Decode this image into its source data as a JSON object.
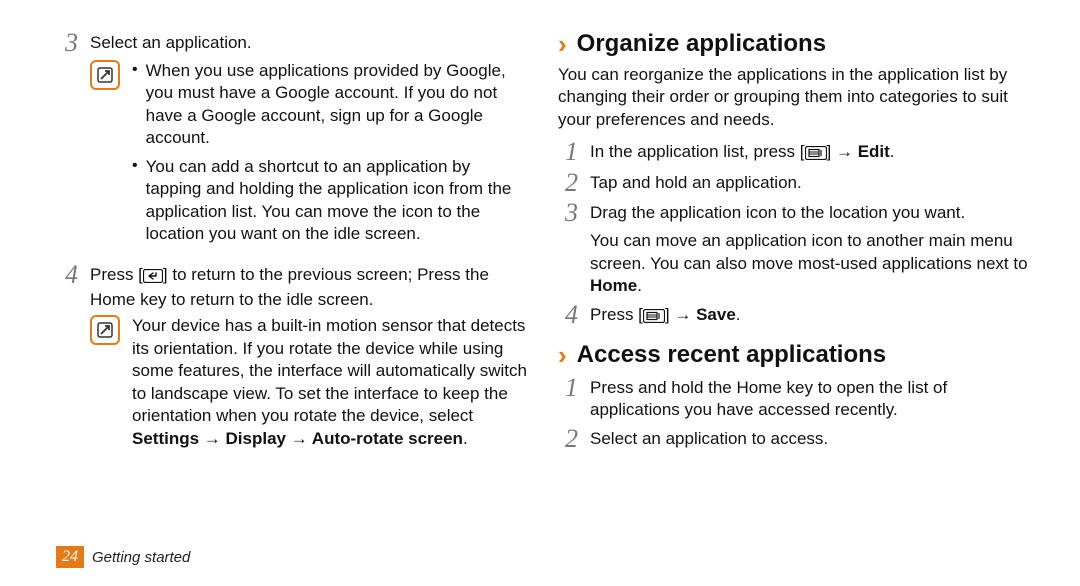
{
  "left": {
    "step3_text": "Select an application.",
    "note1_b1": "When you use applications provided by Google, you must have a Google account. If you do not have a Google account, sign up for a Google account.",
    "note1_b2": "You can add a shortcut to an application by tapping and holding the application icon from the application list. You can move the icon to the location you want on the idle screen.",
    "step4_pre": "Press [",
    "step4_post": "] to return to the previous screen; Press the Home key to return to the idle screen.",
    "note2": "Your device has a built-in motion sensor that detects its orientation. If you rotate the device while using some features, the interface will automatically switch to landscape view. To set the interface to keep the orientation when you rotate the device, select ",
    "note2_bold": "Settings → Display → Auto-rotate screen",
    "note2_tail": "."
  },
  "right": {
    "h_organize": "Organize applications",
    "intro": "You can reorganize the applications in the application list by changing their order or grouping them into categories to suit your preferences and needs.",
    "s1_pre": "In the application list, press [",
    "s1_mid": "] → ",
    "s1_bold": "Edit",
    "s1_tail": ".",
    "s2": "Tap and hold an application.",
    "s3": "Drag the application icon to the location you want.",
    "s3b": "You can move an application icon to another main menu screen. You can also move most-used applications next to ",
    "s3b_bold": "Home",
    "s3b_tail": ".",
    "s4_pre": "Press [",
    "s4_mid": "] → ",
    "s4_bold": "Save",
    "s4_tail": ".",
    "h_recent": "Access recent applications",
    "r1": "Press and hold the Home key to open the list of applications you have accessed recently.",
    "r2": "Select an application to access."
  },
  "nums": {
    "n1": "1",
    "n2": "2",
    "n3": "3",
    "n4": "4"
  },
  "footer": {
    "page": "24",
    "section": "Getting started"
  }
}
